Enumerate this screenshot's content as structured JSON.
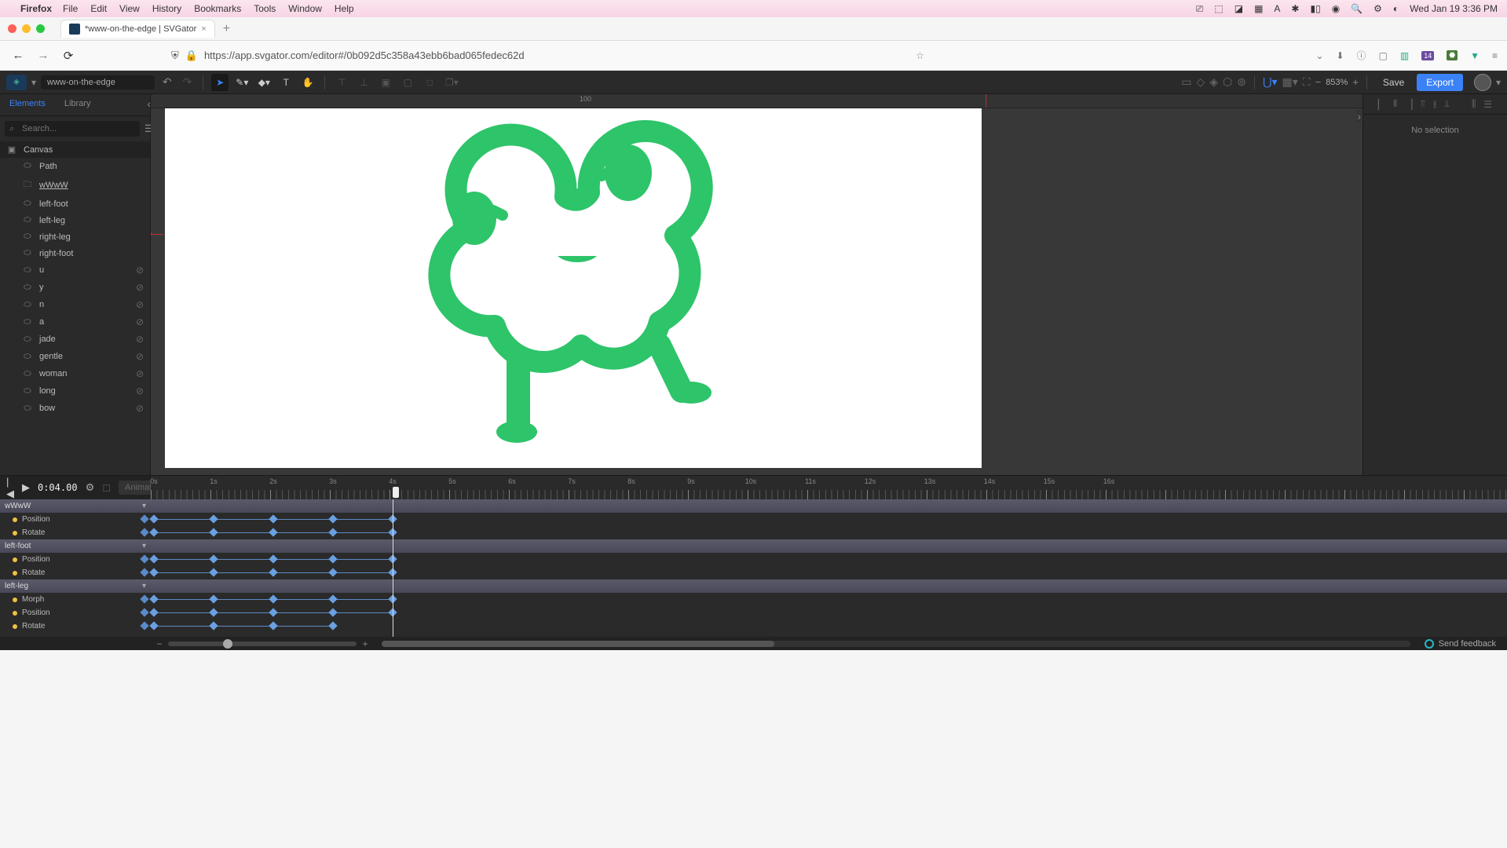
{
  "macos": {
    "app": "Firefox",
    "menus": [
      "File",
      "Edit",
      "View",
      "History",
      "Bookmarks",
      "Tools",
      "Window",
      "Help"
    ],
    "clock": "Wed Jan 19  3:36 PM"
  },
  "browser": {
    "tab_title": "*www-on-the-edge | SVGator",
    "url": "https://app.svgator.com/editor#/0b092d5c358a43ebb6bad065fedec62d"
  },
  "toolbar": {
    "project_name": "www-on-the-edge",
    "zoom": "853%",
    "save": "Save",
    "export": "Export"
  },
  "left_panel": {
    "tabs": {
      "elements": "Elements",
      "library": "Library"
    },
    "search_placeholder": "Search...",
    "canvas_label": "Canvas",
    "layers": [
      {
        "name": "Path",
        "icon": "path",
        "hidden": false
      },
      {
        "name": "wWwW",
        "icon": "folder",
        "hidden": false,
        "selected": true
      },
      {
        "name": "left-foot",
        "icon": "path",
        "hidden": false
      },
      {
        "name": "left-leg",
        "icon": "path",
        "hidden": false
      },
      {
        "name": "right-leg",
        "icon": "path",
        "hidden": false
      },
      {
        "name": "right-foot",
        "icon": "path",
        "hidden": false
      },
      {
        "name": "u",
        "icon": "path",
        "hidden": true
      },
      {
        "name": "y",
        "icon": "path",
        "hidden": true
      },
      {
        "name": "n",
        "icon": "path",
        "hidden": true
      },
      {
        "name": "a",
        "icon": "path",
        "hidden": true
      },
      {
        "name": "jade",
        "icon": "path",
        "hidden": true
      },
      {
        "name": "gentle",
        "icon": "path",
        "hidden": true
      },
      {
        "name": "woman",
        "icon": "path",
        "hidden": true
      },
      {
        "name": "long",
        "icon": "path",
        "hidden": true
      },
      {
        "name": "bow",
        "icon": "path",
        "hidden": true
      }
    ]
  },
  "right_panel": {
    "no_selection": "No selection"
  },
  "ruler": {
    "label_100": "100"
  },
  "timeline": {
    "time": "0:04.00",
    "animate": "Animate",
    "seconds": [
      "0s",
      "1s",
      "2s",
      "3s",
      "4s",
      "5s",
      "6s",
      "7s",
      "8s",
      "9s",
      "10s",
      "11s",
      "12s",
      "13s",
      "14s",
      "15s",
      "16s"
    ],
    "playhead_sec": 4,
    "tracks": [
      {
        "group": "wWwW",
        "props": [
          {
            "name": "Position",
            "keys": [
              0,
              1,
              2,
              3,
              4
            ]
          },
          {
            "name": "Rotate",
            "keys": [
              0,
              1,
              2,
              3,
              4
            ]
          }
        ]
      },
      {
        "group": "left-foot",
        "props": [
          {
            "name": "Position",
            "keys": [
              0,
              1,
              2,
              3,
              4
            ]
          },
          {
            "name": "Rotate",
            "keys": [
              0,
              1,
              2,
              3,
              4
            ]
          }
        ]
      },
      {
        "group": "left-leg",
        "props": [
          {
            "name": "Morph",
            "keys": [
              0,
              1,
              2,
              3,
              4
            ]
          },
          {
            "name": "Position",
            "keys": [
              0,
              1,
              2,
              3,
              4
            ]
          },
          {
            "name": "Rotate",
            "keys": [
              0,
              1,
              2,
              3
            ]
          }
        ]
      }
    ]
  },
  "feedback": {
    "label": "Send feedback"
  },
  "frog_color": "#2ec46a"
}
